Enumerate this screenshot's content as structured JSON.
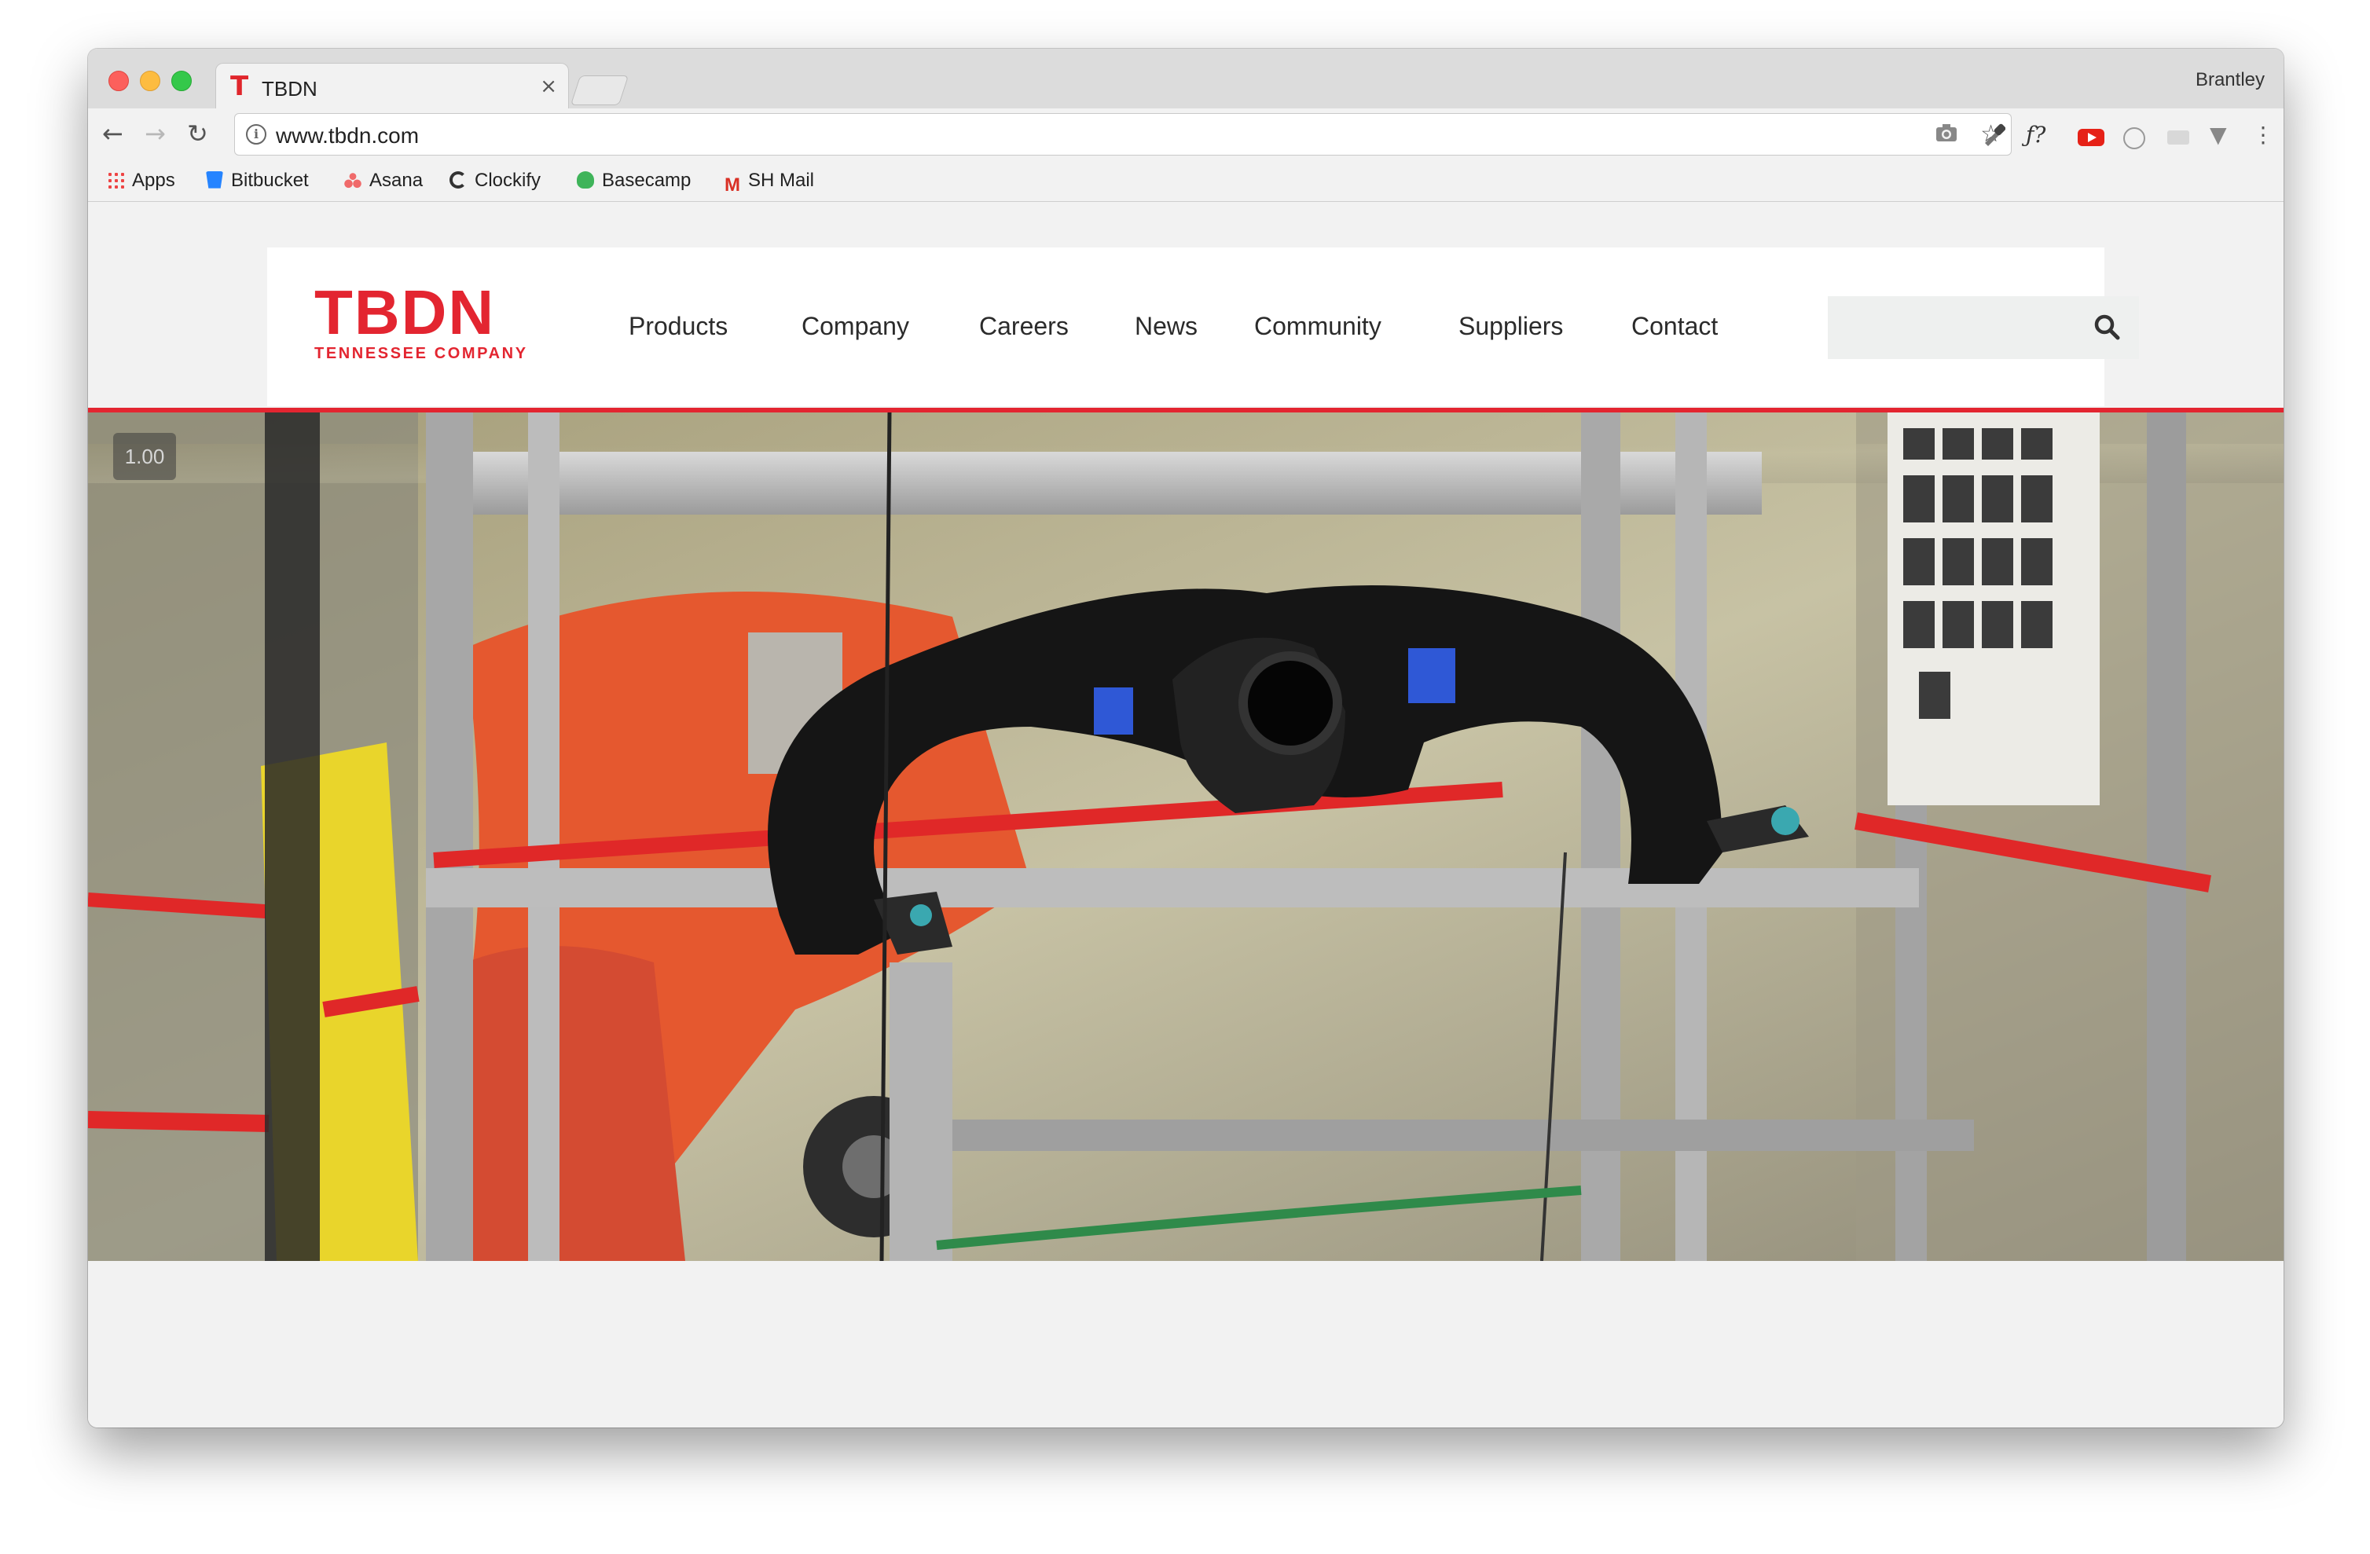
{
  "browser": {
    "tab": {
      "favicon": "T",
      "title": "TBDN",
      "close": "×"
    },
    "profile_name": "Brantley",
    "url": "www.tbdn.com",
    "nav_icons": {
      "back": "back-arrow-icon",
      "forward": "forward-arrow-icon",
      "reload": "reload-icon"
    },
    "bookmarks": [
      {
        "label": "Apps",
        "icon": "apps-grid-icon"
      },
      {
        "label": "Bitbucket",
        "icon": "bitbucket-icon"
      },
      {
        "label": "Asana",
        "icon": "asana-icon"
      },
      {
        "label": "Clockify",
        "icon": "clockify-icon"
      },
      {
        "label": "Basecamp",
        "icon": "basecamp-icon"
      },
      {
        "label": "SH Mail",
        "icon": "gmail-icon"
      }
    ],
    "extension_fx_label": "ƒ?"
  },
  "site": {
    "logo": {
      "main": "TBDN",
      "sub": "TENNESSEE COMPANY",
      "color": "#e32530"
    },
    "nav": [
      "Products",
      "Company",
      "Careers",
      "News",
      "Community",
      "Suppliers",
      "Contact"
    ],
    "search": {
      "placeholder": "",
      "icon": "search-icon"
    },
    "hero": {
      "playback_speed": "1.00"
    }
  },
  "colors": {
    "brand_red": "#e32530",
    "page_bg": "#f2f2f2",
    "search_bg": "#eef0ef"
  }
}
